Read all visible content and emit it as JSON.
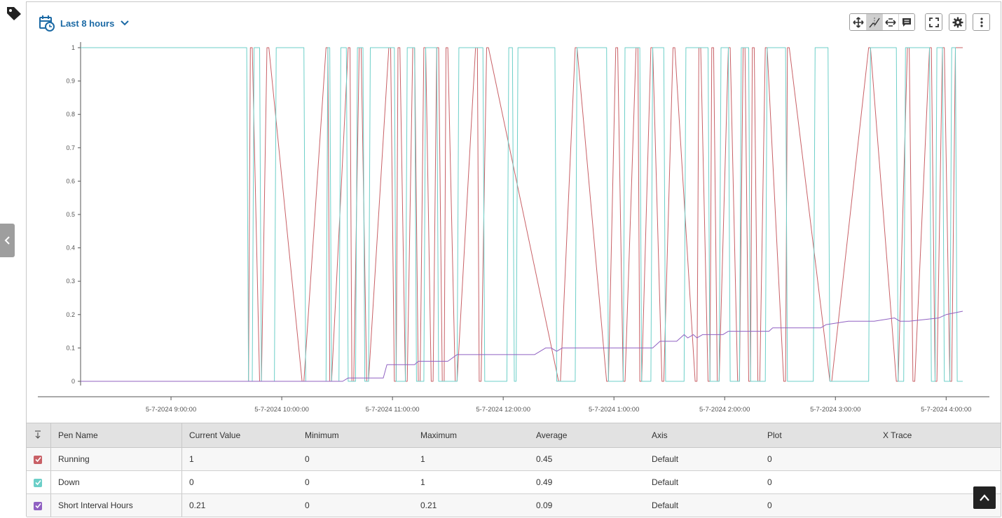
{
  "toolbar": {
    "time_range_label": "Last 8 hours",
    "icons": [
      "calendar-clock-icon",
      "chevron-down-icon",
      "pan-icon",
      "cursor-icon",
      "horizontal-zoom-icon",
      "annotation-icon",
      "fullscreen-icon",
      "gear-icon",
      "more-vertical-icon"
    ]
  },
  "colors": {
    "running": "#c86066",
    "down": "#6ccfc8",
    "short_interval_hours": "#9061c2",
    "accent": "#1c6aa5"
  },
  "chart_data": {
    "type": "line",
    "y_ticks": [
      "0",
      "0.1",
      "0.2",
      "0.3",
      "0.4",
      "0.5",
      "0.6",
      "0.7",
      "0.8",
      "0.9",
      "1"
    ],
    "ylim": [
      0,
      1
    ],
    "x_ticks": [
      "5-7-2024 9:00:00",
      "5-7-2024 10:00:00",
      "5-7-2024 11:00:00",
      "5-7-2024 12:00:00",
      "5-7-2024 1:00:00",
      "5-7-2024 2:00:00",
      "5-7-2024 3:00:00",
      "5-7-2024 4:00:00"
    ],
    "xlim": [
      "5-7-2024 8:11:00",
      "5-7-2024 4:09:00"
    ],
    "grid": false,
    "series": [
      {
        "name": "Running",
        "step": true,
        "x": [
          "8:11",
          "9:42",
          "9:43",
          "9:44",
          "9:48",
          "9:49",
          "9:52",
          "9:53",
          "10:11",
          "10:12",
          "10:24",
          "10:25",
          "10:26",
          "10:27",
          "10:36",
          "10:37",
          "10:38",
          "10:39",
          "10:42",
          "10:43",
          "10:46",
          "10:47",
          "10:58",
          "10:59",
          "11:01",
          "11:02",
          "11:03",
          "11:04",
          "11:07",
          "11:08",
          "11:11",
          "11:12",
          "11:14",
          "11:15",
          "11:17",
          "11:18",
          "11:21",
          "11:22",
          "11:24",
          "11:25",
          "11:27",
          "11:28",
          "11:29",
          "11:30",
          "11:34",
          "11:35",
          "11:45",
          "11:46",
          "11:47",
          "11:48",
          "11:51",
          "11:52",
          "12:30",
          "12:31",
          "12:39",
          "12:40",
          "12:56",
          "12:57",
          "1:01",
          "1:02",
          "1:05",
          "1:06",
          "1:12",
          "1:13",
          "1:14",
          "1:15",
          "1:20",
          "1:21",
          "1:26",
          "1:27",
          "1:32",
          "1:33",
          "1:44",
          "1:45",
          "1:46",
          "1:47",
          "1:51",
          "1:52",
          "1:53",
          "1:54",
          "1:56",
          "1:57",
          "2:02",
          "2:03",
          "2:07",
          "2:08",
          "2:10",
          "2:11",
          "2:13",
          "2:14",
          "2:15",
          "2:16",
          "2:18",
          "2:19",
          "2:22",
          "2:23",
          "2:32",
          "2:33",
          "2:34",
          "2:35",
          "2:57",
          "2:58",
          "3:18",
          "3:19",
          "3:33",
          "3:34",
          "3:39",
          "3:40",
          "3:42",
          "3:43",
          "3:51",
          "3:52",
          "3:54",
          "3:55",
          "3:58",
          "3:59",
          "4:02",
          "4:03",
          "4:05",
          "4:06",
          "4:09"
        ],
        "values": [
          0,
          0,
          1,
          1,
          0,
          0,
          1,
          1,
          0,
          0,
          1,
          1,
          0,
          0,
          1,
          1,
          0,
          0,
          1,
          1,
          0,
          0,
          1,
          1,
          0,
          0,
          1,
          1,
          0,
          0,
          1,
          1,
          0,
          0,
          1,
          1,
          0,
          0,
          1,
          1,
          0,
          0,
          1,
          1,
          0,
          0,
          1,
          1,
          0,
          0,
          1,
          1,
          0,
          0,
          1,
          1,
          0,
          0,
          1,
          1,
          0,
          0,
          1,
          1,
          0,
          0,
          1,
          1,
          0,
          0,
          1,
          1,
          0,
          0,
          1,
          1,
          0,
          0,
          1,
          1,
          0,
          0,
          1,
          1,
          0,
          0,
          1,
          1,
          0,
          0,
          1,
          1,
          0,
          0,
          1,
          1,
          0,
          0,
          1,
          1,
          0,
          0,
          1,
          1,
          0,
          0,
          1,
          1,
          0,
          0,
          1,
          1,
          0,
          0,
          1,
          1,
          0,
          0,
          1,
          1,
          1
        ]
      },
      {
        "name": "Down",
        "step": true,
        "x": [
          "8:11",
          "9:41",
          "9:42",
          "9:44",
          "9:45",
          "9:48",
          "9:49",
          "9:56",
          "9:57",
          "10:12",
          "10:13",
          "10:24",
          "10:25",
          "10:26",
          "10:27",
          "10:31",
          "10:32",
          "10:35",
          "10:36",
          "10:40",
          "10:41",
          "10:44",
          "10:45",
          "10:47",
          "10:48",
          "11:01",
          "11:02",
          "11:07",
          "11:08",
          "11:12",
          "11:13",
          "11:17",
          "11:18",
          "11:24",
          "11:25",
          "11:35",
          "11:36",
          "11:49",
          "11:50",
          "12:02",
          "12:03",
          "12:05",
          "12:06",
          "12:07",
          "12:08",
          "12:28",
          "12:29",
          "12:39",
          "12:40",
          "12:56",
          "12:57",
          "1:05",
          "1:06",
          "1:14",
          "1:15",
          "1:20",
          "1:21",
          "1:27",
          "1:28",
          "1:38",
          "1:39",
          "1:51",
          "1:52",
          "1:57",
          "1:58",
          "2:02",
          "2:03",
          "2:08",
          "2:09",
          "2:13",
          "2:14",
          "2:22",
          "2:23",
          "2:33",
          "2:34",
          "2:48",
          "2:49",
          "2:56",
          "2:57",
          "3:18",
          "3:19",
          "3:33",
          "3:34",
          "3:37",
          "3:38",
          "3:51",
          "3:52",
          "3:54",
          "3:55",
          "3:58",
          "3:59",
          "4:02",
          "4:03",
          "4:05",
          "4:06",
          "4:09"
        ],
        "values": [
          1,
          1,
          0,
          0,
          1,
          1,
          0,
          0,
          1,
          1,
          0,
          0,
          1,
          1,
          0,
          0,
          1,
          1,
          0,
          0,
          1,
          1,
          0,
          0,
          1,
          1,
          0,
          0,
          1,
          1,
          0,
          0,
          1,
          1,
          0,
          0,
          1,
          1,
          0,
          0,
          1,
          1,
          0,
          0,
          1,
          1,
          0,
          0,
          1,
          1,
          0,
          0,
          1,
          1,
          0,
          0,
          1,
          1,
          0,
          0,
          1,
          1,
          0,
          0,
          1,
          1,
          0,
          0,
          1,
          1,
          0,
          0,
          1,
          1,
          0,
          0,
          1,
          1,
          0,
          0,
          1,
          1,
          0,
          0,
          1,
          1,
          0,
          0,
          1,
          1,
          0,
          0,
          1,
          1,
          0,
          0
        ]
      },
      {
        "name": "Short Interval Hours",
        "step": false,
        "x": [
          "8:11",
          "10:33",
          "10:36",
          "10:38",
          "10:55",
          "10:57",
          "11:12",
          "11:14",
          "11:30",
          "11:35",
          "12:17",
          "12:23",
          "12:26",
          "12:29",
          "12:32",
          "12:38",
          "13:21",
          "13:25",
          "13:34",
          "13:38",
          "13:40",
          "13:43",
          "13:45",
          "13:48",
          "13:55",
          "13:59",
          "14:02",
          "14:24",
          "14:26",
          "14:52",
          "14:55",
          "15:07",
          "15:11",
          "15:21",
          "15:32",
          "15:35",
          "15:40",
          "15:56",
          "16:00",
          "16:09"
        ],
        "values": [
          0,
          0,
          0.01,
          0.01,
          0.01,
          0.05,
          0.05,
          0.06,
          0.06,
          0.08,
          0.08,
          0.1,
          0.1,
          0.09,
          0.1,
          0.1,
          0.1,
          0.12,
          0.12,
          0.14,
          0.13,
          0.14,
          0.13,
          0.14,
          0.14,
          0.14,
          0.15,
          0.15,
          0.16,
          0.16,
          0.17,
          0.18,
          0.18,
          0.18,
          0.19,
          0.18,
          0.18,
          0.19,
          0.2,
          0.21
        ]
      }
    ]
  },
  "pen_table": {
    "columns": [
      "Pen Name",
      "Current Value",
      "Minimum",
      "Maximum",
      "Average",
      "Axis",
      "Plot",
      "X Trace"
    ],
    "rows": [
      {
        "name": "Running",
        "current": "1",
        "minimum": "0",
        "maximum": "1",
        "average": "0.45",
        "axis": "Default",
        "plot": "0",
        "x_trace": "",
        "checkbox_color": "#c86066",
        "checked": true
      },
      {
        "name": "Down",
        "current": "0",
        "minimum": "0",
        "maximum": "1",
        "average": "0.49",
        "axis": "Default",
        "plot": "0",
        "x_trace": "",
        "checkbox_color": "#6ccfc8",
        "checked": true
      },
      {
        "name": "Short Interval Hours",
        "current": "0.21",
        "minimum": "0",
        "maximum": "0.21",
        "average": "0.09",
        "axis": "Default",
        "plot": "0",
        "x_trace": "",
        "checkbox_color": "#9061c2",
        "checked": true
      }
    ]
  }
}
